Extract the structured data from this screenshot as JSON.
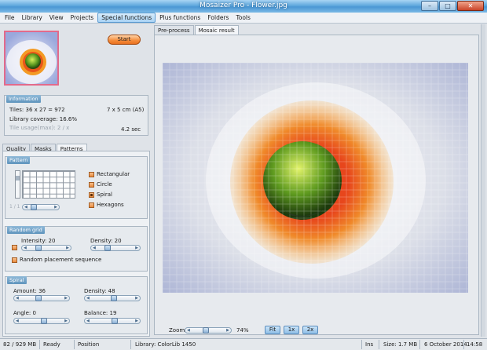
{
  "window": {
    "title": "Mosaizer Pro - Flower.jpg",
    "minimize": "–",
    "maximize": "□",
    "close": "✕"
  },
  "menu": [
    "File",
    "Library",
    "View",
    "Projects",
    "Special functions",
    "Plus functions",
    "Folders",
    "Tools"
  ],
  "menu_active": "Special functions",
  "start_label": "Start",
  "information": {
    "title": "Information",
    "tiles": "Tiles: 36 x 27 = 972",
    "size": "7 x 5 cm (A5)",
    "coverage": "Library coverage: 16.6%",
    "usage": "Tile usage(max): 2 / x",
    "time": "4.2 sec"
  },
  "tabs_left": [
    "Quality",
    "Masks",
    "Patterns"
  ],
  "tabs_left_active": "Patterns",
  "pattern": {
    "title": "Pattern",
    "options": [
      {
        "label": "Rectangular",
        "selected": false
      },
      {
        "label": "Circle",
        "selected": false
      },
      {
        "label": "Spiral",
        "selected": true
      },
      {
        "label": "Hexagons",
        "selected": false
      }
    ],
    "slider_hint": "1 / 1"
  },
  "random_grid": {
    "title": "Random grid",
    "intensity_label": "Intensity: 20",
    "density_label": "Density: 20",
    "intensity": 20,
    "density": 20,
    "placement_label": "Random placement sequence"
  },
  "spiral": {
    "title": "Spiral",
    "amount_label": "Amount: 36",
    "density_label": "Density: 48",
    "angle_label": "Angle: 0",
    "balance_label": "Balance: 19",
    "amount": 36,
    "density": 48,
    "angle": 0,
    "balance": 19
  },
  "tabs_right": [
    "Pre-process",
    "Mosaic result"
  ],
  "tabs_right_active": "Mosaic result",
  "zoom": {
    "label": "Zoom",
    "value_text": "74%",
    "value": 74,
    "fit": "Fit",
    "one": "1x",
    "two": "2x"
  },
  "status": {
    "memory": "82 / 929 MB",
    "state": "Ready",
    "position": "Position",
    "library": "Library: ColorLib 1450",
    "mode": "Ins",
    "size": "Size: 1.7 MB",
    "date": "6 October 2014",
    "time": "14:58"
  },
  "colors": {
    "accent": "#5f94bd",
    "start": "#f58c3a",
    "checkbox": "#e88a3d"
  }
}
